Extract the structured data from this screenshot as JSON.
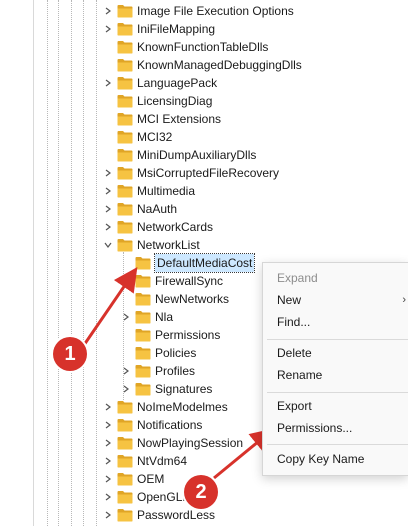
{
  "tree": {
    "items": [
      {
        "label": "Image File Execution Options",
        "expander": "collapsed"
      },
      {
        "label": "IniFileMapping",
        "expander": "collapsed"
      },
      {
        "label": "KnownFunctionTableDlls",
        "expander": "none"
      },
      {
        "label": "KnownManagedDebuggingDlls",
        "expander": "none"
      },
      {
        "label": "LanguagePack",
        "expander": "collapsed"
      },
      {
        "label": "LicensingDiag",
        "expander": "none"
      },
      {
        "label": "MCI Extensions",
        "expander": "none"
      },
      {
        "label": "MCI32",
        "expander": "none"
      },
      {
        "label": "MiniDumpAuxiliaryDlls",
        "expander": "none"
      },
      {
        "label": "MsiCorruptedFileRecovery",
        "expander": "collapsed"
      },
      {
        "label": "Multimedia",
        "expander": "collapsed"
      },
      {
        "label": "NaAuth",
        "expander": "collapsed"
      },
      {
        "label": "NetworkCards",
        "expander": "collapsed"
      },
      {
        "label": "NetworkList",
        "expander": "expanded"
      },
      {
        "label": "DefaultMediaCost",
        "expander": "none",
        "child": true,
        "selected": true
      },
      {
        "label": "FirewallSync",
        "expander": "none",
        "child": true
      },
      {
        "label": "NewNetworks",
        "expander": "none",
        "child": true
      },
      {
        "label": "Nla",
        "expander": "collapsed",
        "child": true
      },
      {
        "label": "Permissions",
        "expander": "none",
        "child": true
      },
      {
        "label": "Policies",
        "expander": "none",
        "child": true
      },
      {
        "label": "Profiles",
        "expander": "collapsed",
        "child": true
      },
      {
        "label": "Signatures",
        "expander": "collapsed",
        "child": true
      },
      {
        "label": "NoImeModelmes",
        "expander": "collapsed"
      },
      {
        "label": "Notifications",
        "expander": "collapsed"
      },
      {
        "label": "NowPlayingSession",
        "expander": "collapsed"
      },
      {
        "label": "NtVdm64",
        "expander": "collapsed"
      },
      {
        "label": "OEM",
        "expander": "collapsed"
      },
      {
        "label": "OpenGLD",
        "expander": "collapsed"
      },
      {
        "label": "PasswordLess",
        "expander": "collapsed"
      }
    ]
  },
  "context_menu": {
    "expand": "Expand",
    "new": "New",
    "find": "Find...",
    "delete": "Delete",
    "rename": "Rename",
    "export": "Export",
    "permissions": "Permissions...",
    "copy_key_name": "Copy Key Name"
  },
  "callouts": {
    "one": "1",
    "two": "2"
  },
  "colors": {
    "folder": "#f6c342",
    "folder_dark": "#e0a526",
    "selection": "#cde8ff",
    "callout": "#d7322b"
  }
}
